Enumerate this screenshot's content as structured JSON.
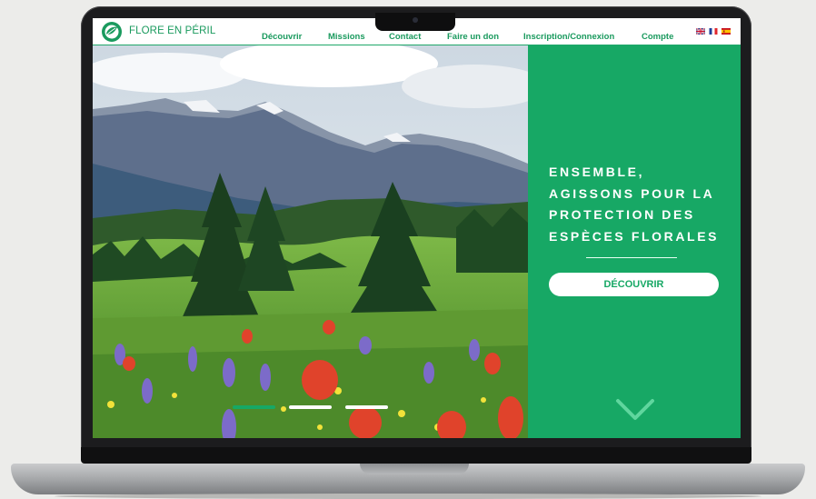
{
  "header": {
    "brand": "FLORE EN PÉRIL",
    "nav": [
      {
        "label": "Découvrir"
      },
      {
        "label": "Missions"
      },
      {
        "label": "Contact"
      },
      {
        "label": "Faire un don"
      },
      {
        "label": "Inscription/Connexion"
      },
      {
        "label": "Compte"
      }
    ],
    "languages": [
      "uk-flag-icon",
      "fr-flag-icon",
      "es-flag-icon"
    ]
  },
  "hero": {
    "headline_lines": [
      "ENSEMBLE,",
      "AGISSONS POUR LA",
      "PROTECTION DES",
      "ESPÈCES FLORALES"
    ],
    "cta_label": "DÉCOUVRIR",
    "slides_total": 3,
    "active_slide": 1
  },
  "colors": {
    "brand_green": "#17a865",
    "text_green": "#1a9a5e",
    "active_dot": "#17a865",
    "inactive_dot": "#ffffff"
  }
}
